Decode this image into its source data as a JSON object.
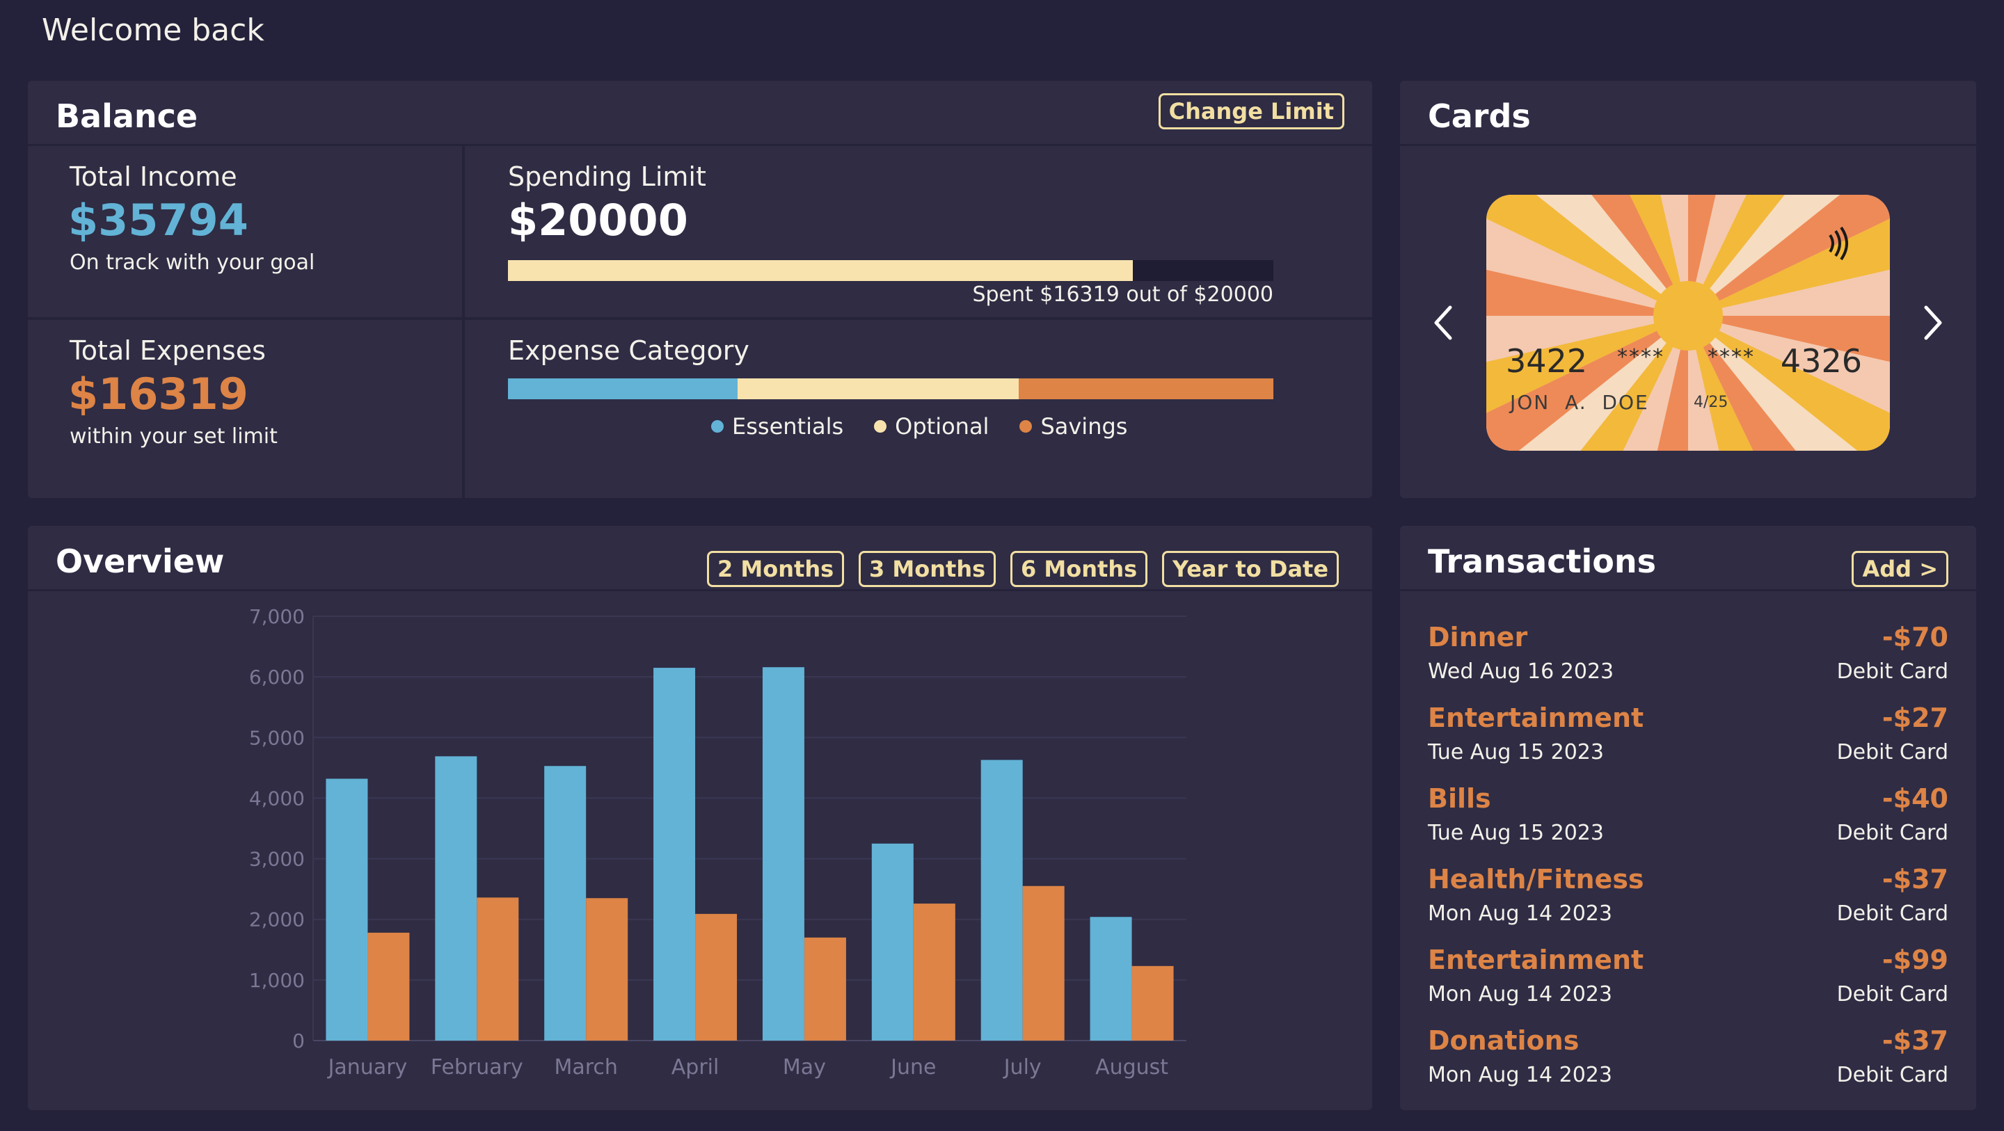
{
  "welcome": "Welcome back",
  "balance": {
    "title": "Balance",
    "change_limit_label": "Change Limit",
    "total_income": {
      "label": "Total Income",
      "value": "$35794",
      "note": "On track with your goal"
    },
    "total_expenses": {
      "label": "Total Expenses",
      "value": "$16319",
      "note": "within your set limit"
    },
    "spending_limit": {
      "label": "Spending Limit",
      "value": "$20000",
      "spent_text": "Spent $16319 out of $20000",
      "spent_fraction": 0.816
    },
    "expense_category": {
      "label": "Expense Category",
      "segments": [
        {
          "name": "Essentials",
          "fraction": 0.3,
          "color": "#62b3d6"
        },
        {
          "name": "Optional",
          "fraction": 0.367,
          "color": "#f8e3ae"
        },
        {
          "name": "Savings",
          "fraction": 0.333,
          "color": "#dd8446"
        }
      ]
    }
  },
  "cards": {
    "title": "Cards",
    "card": {
      "first": "3422",
      "mask1": "****",
      "mask2": "****",
      "last": "4326",
      "holder": "JON  A.  DOE",
      "expiry": "4/25"
    },
    "prev_icon": "chevron-left-icon",
    "next_icon": "chevron-right-icon"
  },
  "overview": {
    "title": "Overview",
    "filters": [
      "2 Months",
      "3 Months",
      "6 Months",
      "Year to Date"
    ]
  },
  "chart_data": {
    "type": "bar",
    "categories": [
      "January",
      "February",
      "March",
      "April",
      "May",
      "June",
      "July",
      "August"
    ],
    "series": [
      {
        "values": [
          4320,
          4690,
          4530,
          6150,
          6160,
          3250,
          4630,
          2040
        ],
        "color": "#62b3d6"
      },
      {
        "values": [
          1780,
          2360,
          2350,
          2090,
          1700,
          2260,
          2550,
          1230
        ],
        "color": "#dd8446"
      }
    ],
    "ylim": [
      0,
      7000
    ],
    "yticks": [
      "0",
      "1,000",
      "2,000",
      "3,000",
      "4,000",
      "5,000",
      "6,000",
      "7,000"
    ],
    "grid": true
  },
  "transactions": {
    "title": "Transactions",
    "add_label": "Add >",
    "items": [
      {
        "name": "Dinner",
        "date": "Wed Aug 16 2023",
        "amount": "-$70",
        "method": "Debit Card"
      },
      {
        "name": "Entertainment",
        "date": "Tue Aug 15 2023",
        "amount": "-$27",
        "method": "Debit Card"
      },
      {
        "name": "Bills",
        "date": "Tue Aug 15 2023",
        "amount": "-$40",
        "method": "Debit Card"
      },
      {
        "name": "Health/Fitness",
        "date": "Mon Aug 14 2023",
        "amount": "-$37",
        "method": "Debit Card"
      },
      {
        "name": "Entertainment",
        "date": "Mon Aug 14 2023",
        "amount": "-$99",
        "method": "Debit Card"
      },
      {
        "name": "Donations",
        "date": "Mon Aug 14 2023",
        "amount": "-$37",
        "method": "Debit Card"
      }
    ]
  }
}
